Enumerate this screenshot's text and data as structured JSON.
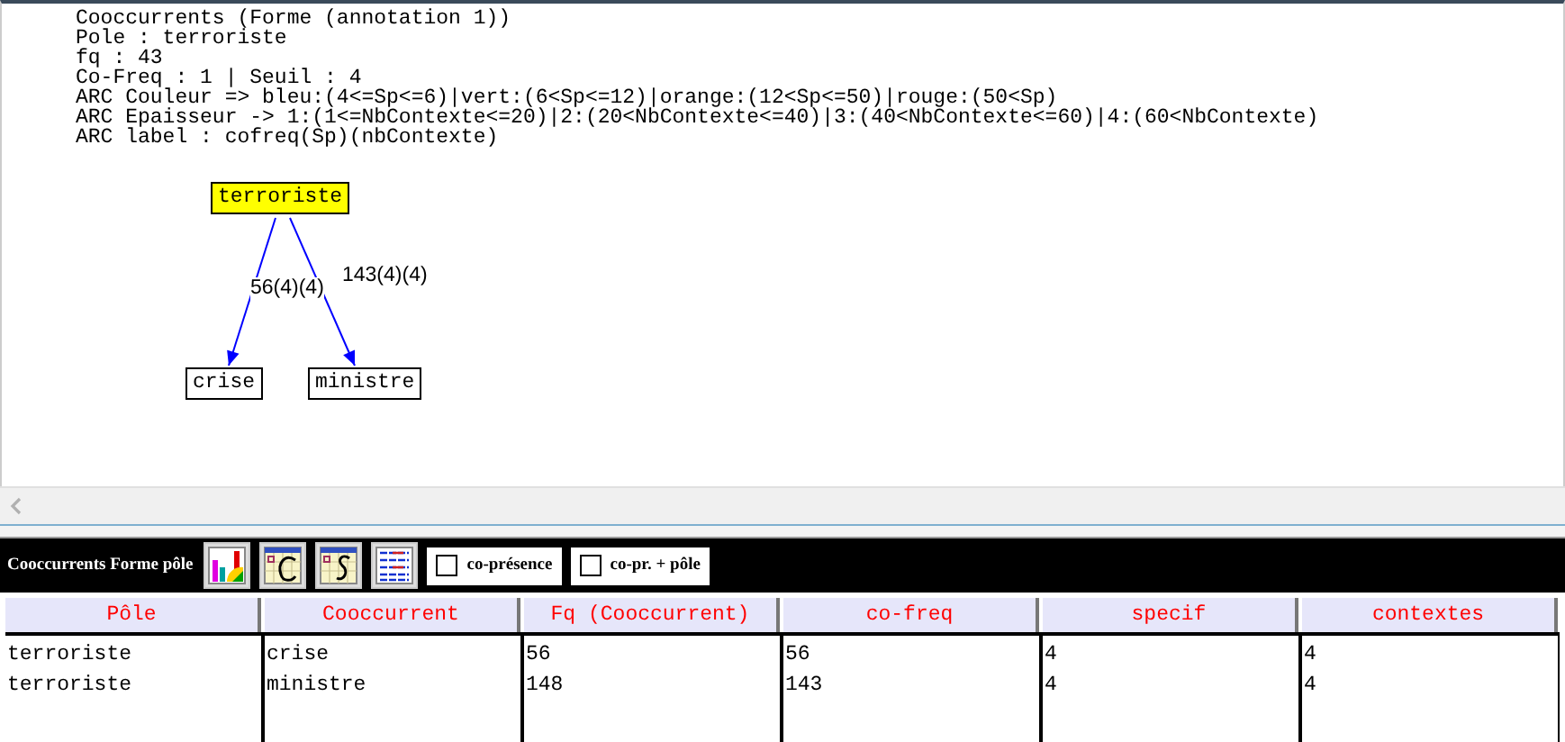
{
  "header_lines": [
    "Cooccurrents (Forme (annotation 1))",
    "Pole : terroriste",
    "fq : 43",
    "Co-Freq : 1 | Seuil : 4",
    "ARC Couleur => bleu:(4<=Sp<=6)|vert:(6<Sp<=12)|orange:(12<Sp<=50)|rouge:(50<Sp)",
    "ARC Epaisseur -> 1:(1<=NbContexte<=20)|2:(20<NbContexte<=40)|3:(40<NbContexte<=60)|4:(60<NbContexte)",
    "ARC label : cofreq(Sp)(nbContexte)"
  ],
  "graph": {
    "pole": "terroriste",
    "edges": [
      {
        "target": "crise",
        "label": "56(4)(4)",
        "color": "#0000ff"
      },
      {
        "target": "ministre",
        "label": "143(4)(4)",
        "color": "#0000ff"
      }
    ]
  },
  "toolbar": {
    "title": "Cooccurrents Forme pôle",
    "buttons": [
      {
        "kind": "chart"
      },
      {
        "kind": "c"
      },
      {
        "kind": "s"
      },
      {
        "kind": "list"
      }
    ],
    "checkboxes": [
      {
        "label": "co-présence",
        "checked": false
      },
      {
        "label": "co-pr. + pôle",
        "checked": false
      }
    ]
  },
  "table": {
    "columns": [
      "Pôle",
      "Cooccurrent",
      "Fq (Cooccurrent)",
      "co-freq",
      "specif",
      "contextes"
    ],
    "rows": [
      [
        "terroriste",
        "crise",
        "56",
        "56",
        "4",
        "4"
      ],
      [
        "terroriste",
        "ministre",
        "148",
        "143",
        "4",
        "4"
      ]
    ]
  }
}
